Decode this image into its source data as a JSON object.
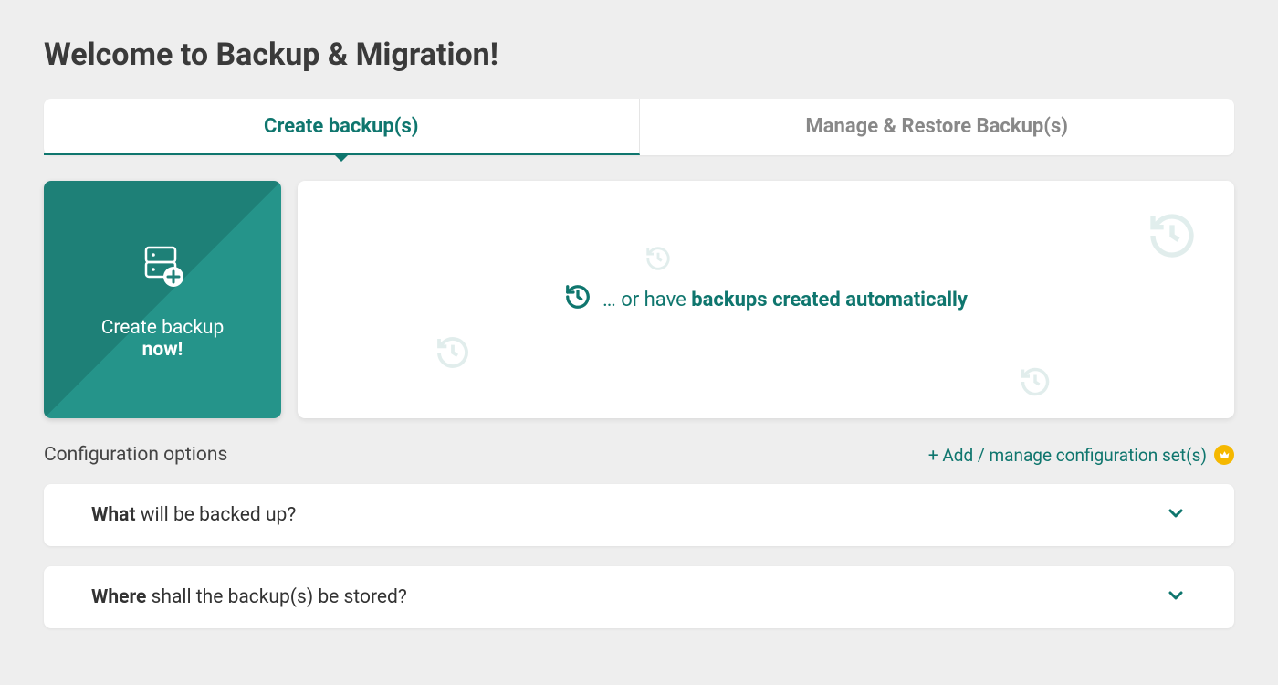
{
  "header": {
    "title": "Welcome to Backup & Migration!"
  },
  "tabs": {
    "create": "Create backup(s)",
    "manage": "Manage & Restore Backup(s)"
  },
  "actions": {
    "create_now_line1": "Create backup",
    "create_now_line2": "now!",
    "auto_prefix": "… or have ",
    "auto_bold": "backups created automatically"
  },
  "config": {
    "label": "Configuration options",
    "add_link": "+ Add / manage configuration set(s)"
  },
  "accordions": {
    "what_bold": "What",
    "what_rest": " will be backed up?",
    "where_bold": "Where",
    "where_rest": " shall the backup(s) be stored?"
  }
}
